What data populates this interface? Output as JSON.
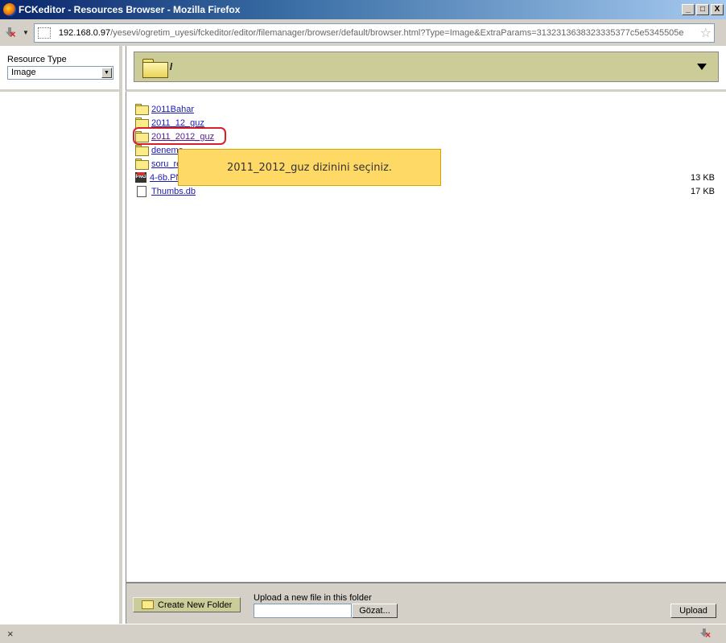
{
  "window": {
    "title": "FCKeditor - Resources Browser - Mozilla Firefox",
    "minimize": "_",
    "maximize": "□",
    "close": "X"
  },
  "navbar": {
    "url_host": "192.168.0.97",
    "url_path": "/yesevi/ogretim_uyesi/fckeditor/editor/filemanager/browser/default/browser.html?Type=Image&ExtraParams=3132313638323335377c5e5345505e",
    "dropdown_glyph": "▼",
    "bookmark_glyph": "☆"
  },
  "sidebar": {
    "resource_type_label": "Resource Type",
    "resource_type_value": "Image",
    "dropdown_glyph": "▼"
  },
  "folderbar": {
    "current_path": "/"
  },
  "files": [
    {
      "name": "2011Bahar",
      "type": "folder",
      "size": ""
    },
    {
      "name": "2011_12_guz",
      "type": "folder",
      "size": ""
    },
    {
      "name": "2011_2012_guz",
      "type": "folder",
      "size": ""
    },
    {
      "name": "deneme",
      "type": "folder",
      "size": ""
    },
    {
      "name": "soru_re",
      "type": "folder",
      "size": ""
    },
    {
      "name": "4-6b.PN",
      "type": "png",
      "size": "13 KB"
    },
    {
      "name": "Thumbs.db",
      "type": "file",
      "size": "17 KB"
    }
  ],
  "png_badge": "PNG",
  "tooltip": {
    "text": "2011_2012_guz dizinini seçiniz."
  },
  "bottombar": {
    "create_folder_label": "Create New Folder",
    "upload_label": "Upload a new file in this folder",
    "browse_label": "Gözat...",
    "upload_button": "Upload"
  },
  "statusbar": {
    "close_glyph": "×"
  }
}
